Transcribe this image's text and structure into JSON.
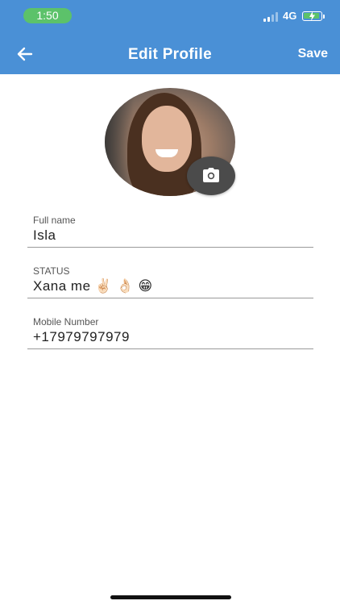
{
  "status_bar": {
    "time": "1:50",
    "network": "4G"
  },
  "header": {
    "title": "Edit Profile",
    "save_label": "Save"
  },
  "fields": [
    {
      "label": "Full name",
      "value": "Isla"
    },
    {
      "label": "STATUS",
      "value": "Xana me ✌🏻 👌🏻 😁"
    },
    {
      "label": "Mobile Number",
      "value": "+17979797979"
    }
  ],
  "icons": {
    "back": "arrow-left-icon",
    "camera": "camera-icon",
    "signal": "signal-icon",
    "battery": "battery-charging-icon"
  },
  "colors": {
    "header_bg": "#4a90d6",
    "time_pill": "#5cc26a",
    "camera_button": "#4b4b4b"
  }
}
